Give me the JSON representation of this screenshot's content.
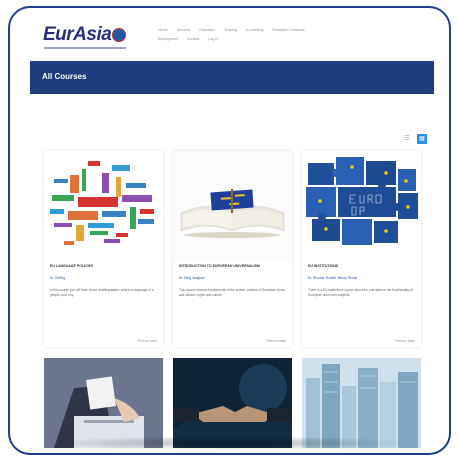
{
  "brand": {
    "logo": "EurAsia"
  },
  "nav": {
    "items": [
      "Home",
      "Services",
      "Education",
      "Training",
      "e-Learning",
      "Education Guidance",
      "Employment",
      "Contact",
      "Log in"
    ]
  },
  "banner": {
    "title": "All Courses"
  },
  "view_toggle": {
    "list_icon": "☰",
    "grid_icon": "▦"
  },
  "courses": [
    {
      "title": "EU LANGUAGE POLICIES",
      "author": "Dr. Griffing",
      "desc": "In this course you will learn about multilingualism, what is a language of a people, and why.",
      "link": "Find out more"
    },
    {
      "title": "INTRODUCTION TO EUROPEAN UNIVERSALISM",
      "author": "Dr. Wing Vaughan",
      "desc": "This course teaches fundamental of the culture, policies of European Union and citizens’ rights and culture.",
      "link": "Find out more"
    },
    {
      "title": "EU INSTITUTIONS",
      "author": "Dr. Rhondo, Rodele, Messy Rende",
      "desc": "There is a EU institutions course about the principles of the functionality of European union and subjects.",
      "link": "Find out more"
    }
  ]
}
